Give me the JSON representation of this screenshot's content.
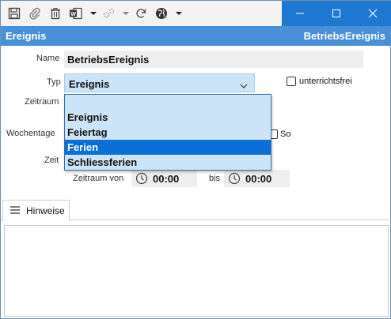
{
  "toolbar": {
    "icons": [
      "save-icon",
      "attach-icon",
      "delete-icon",
      "word-export-icon",
      "settings-icon",
      "refresh-icon",
      "globe-icon"
    ]
  },
  "window_controls": [
    "minimize-icon",
    "maximize-icon",
    "close-icon"
  ],
  "header": {
    "left_title": "Ereignis",
    "right_title": "BetriebsEreignis"
  },
  "form": {
    "name_label": "Name",
    "name_value": "BetriebsEreignis",
    "typ_label": "Typ",
    "typ_value": "Ereignis",
    "unterrichtsfrei_label": "unterrichtsfrei",
    "zeitraum_label": "Zeitraum",
    "wochentage_label": "Wochentage",
    "so_label": "So",
    "zeit_label": "Zeit",
    "zeitraum_von_label": "Zeitraum von",
    "von_value": "00:00",
    "bis_label": "bis",
    "bis_value": "00:00"
  },
  "dropdown": {
    "options": [
      "",
      "Ereignis",
      "Feiertag",
      "Ferien",
      "Schliessferien"
    ],
    "highlighted": "Ferien"
  },
  "tabs": {
    "hinweise_label": "Hinweise"
  },
  "colors": {
    "accent": "#1e78d2",
    "header_band": "#4a90d9",
    "dropdown_bg": "#cce4f7",
    "selection": "#0b6fd8"
  }
}
